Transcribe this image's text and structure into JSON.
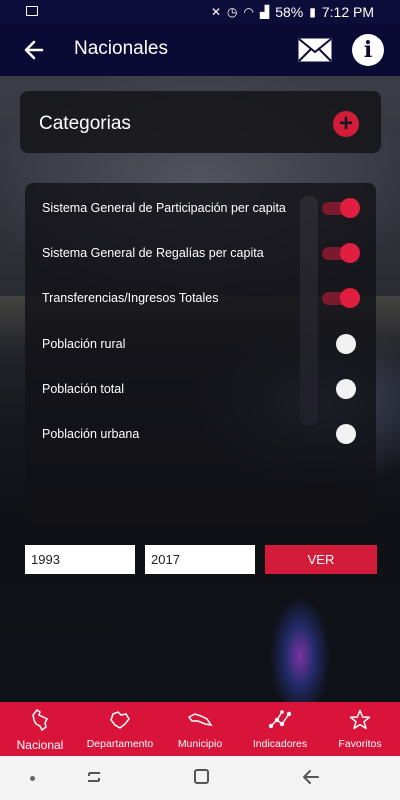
{
  "status_bar": {
    "battery": "58%",
    "time": "7:12 PM"
  },
  "header": {
    "title": "Nacionales"
  },
  "categorias": {
    "label": "Categorias"
  },
  "options": [
    {
      "label": "Sistema General de Participación per capita",
      "on": true
    },
    {
      "label": "Sistema General de Regalías per capita",
      "on": true
    },
    {
      "label": "Transferencias/Ingresos Totales",
      "on": true
    },
    {
      "label": "Población rural",
      "on": false
    },
    {
      "label": "Población total",
      "on": false
    },
    {
      "label": "Población urbana",
      "on": false
    }
  ],
  "range": {
    "from_year": "1993",
    "to_year": "2017",
    "submit_label": "VER"
  },
  "tabs": [
    {
      "label": "Nacional",
      "icon": "colombia-map-icon",
      "active": true
    },
    {
      "label": "Departamento",
      "icon": "department-map-icon",
      "active": false
    },
    {
      "label": "Municipio",
      "icon": "municipality-map-icon",
      "active": false
    },
    {
      "label": "Indicadores",
      "icon": "network-chart-icon",
      "active": false
    },
    {
      "label": "Favoritos",
      "icon": "star-icon",
      "active": false
    }
  ],
  "colors": {
    "header": "#0b0a35",
    "accent": "#d31c3a",
    "tabbar": "#d8143a"
  }
}
